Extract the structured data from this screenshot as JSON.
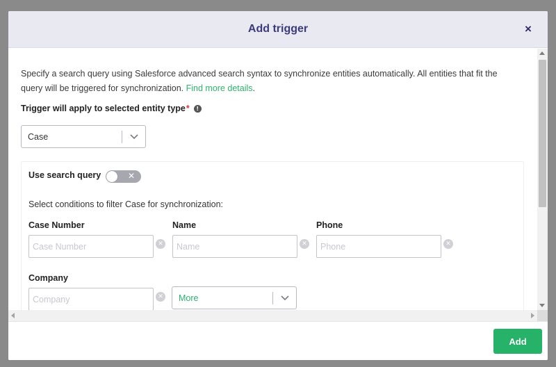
{
  "modal": {
    "title": "Add trigger",
    "close_label": "×"
  },
  "description": {
    "text": "Specify a search query using Salesforce advanced search syntax to synchronize entities automatically. All entities that fit the query will be triggered for synchronization. ",
    "link_text": "Find more details",
    "suffix": "."
  },
  "entity_type": {
    "label": "Trigger will apply to selected entity type",
    "required_mark": "*",
    "info_icon": "info-icon",
    "selected": "Case"
  },
  "search_query": {
    "label": "Use search query",
    "toggle_on": false,
    "toggle_off_glyph": "✕"
  },
  "filter": {
    "instructions": "Select conditions to filter Case for synchronization:",
    "fields": [
      {
        "label": "Case Number",
        "placeholder": "Case Number",
        "value": ""
      },
      {
        "label": "Name",
        "placeholder": "Name",
        "value": ""
      },
      {
        "label": "Phone",
        "placeholder": "Phone",
        "value": ""
      },
      {
        "label": "Company",
        "placeholder": "Company",
        "value": ""
      }
    ],
    "clear_glyph": "✕",
    "more_select": "More"
  },
  "footer": {
    "add_label": "Add"
  },
  "colors": {
    "accent_green": "#27b26a",
    "link_green": "#2db36e",
    "title_indigo": "#3b3a7a",
    "header_bg": "#e9e9f2"
  }
}
